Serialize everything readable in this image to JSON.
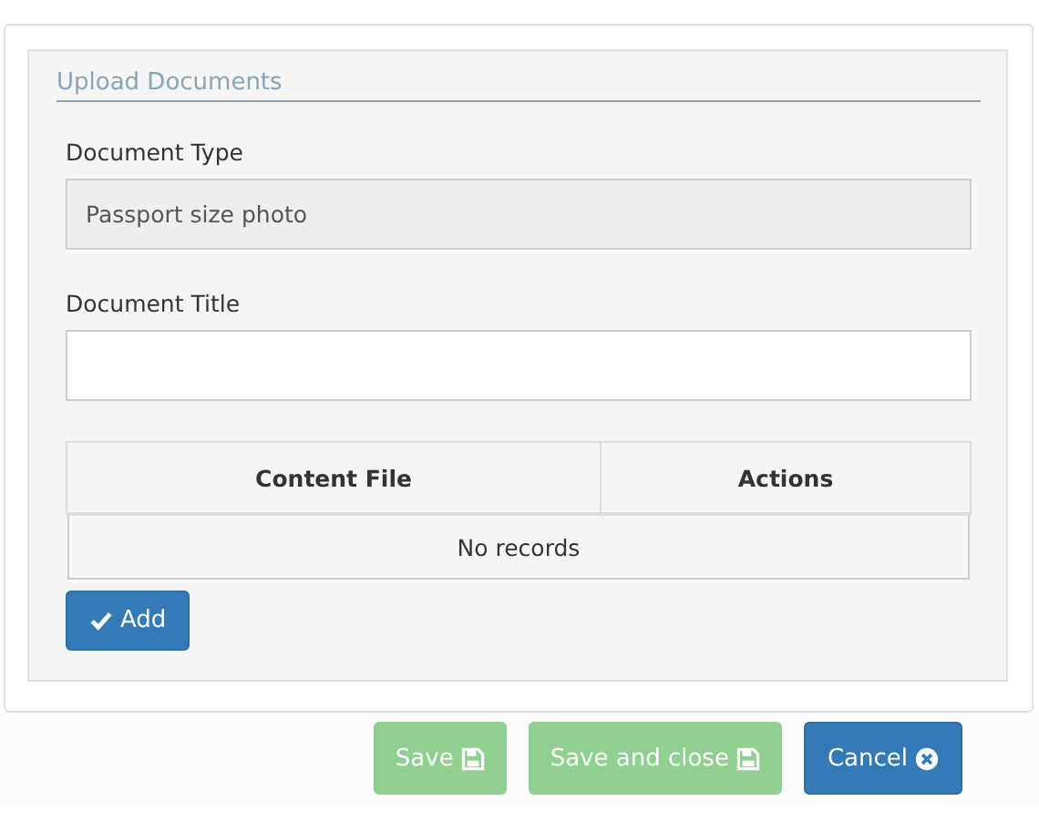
{
  "section": {
    "legend": "Upload Documents"
  },
  "fields": [
    {
      "label": "Document Type",
      "value": "Passport size photo",
      "disabled": true
    },
    {
      "label": "Document Title",
      "disabled": false
    }
  ],
  "table": {
    "columns": [
      "Content File",
      "Actions"
    ],
    "empty_text": "No records"
  },
  "add_button": {
    "label": "Add"
  },
  "footer_buttons": [
    {
      "label": "Save",
      "kind": "success",
      "disabled": true
    },
    {
      "label": "Save and close",
      "kind": "success",
      "disabled": true
    },
    {
      "label": "Cancel",
      "kind": "primary",
      "disabled": false
    }
  ]
}
